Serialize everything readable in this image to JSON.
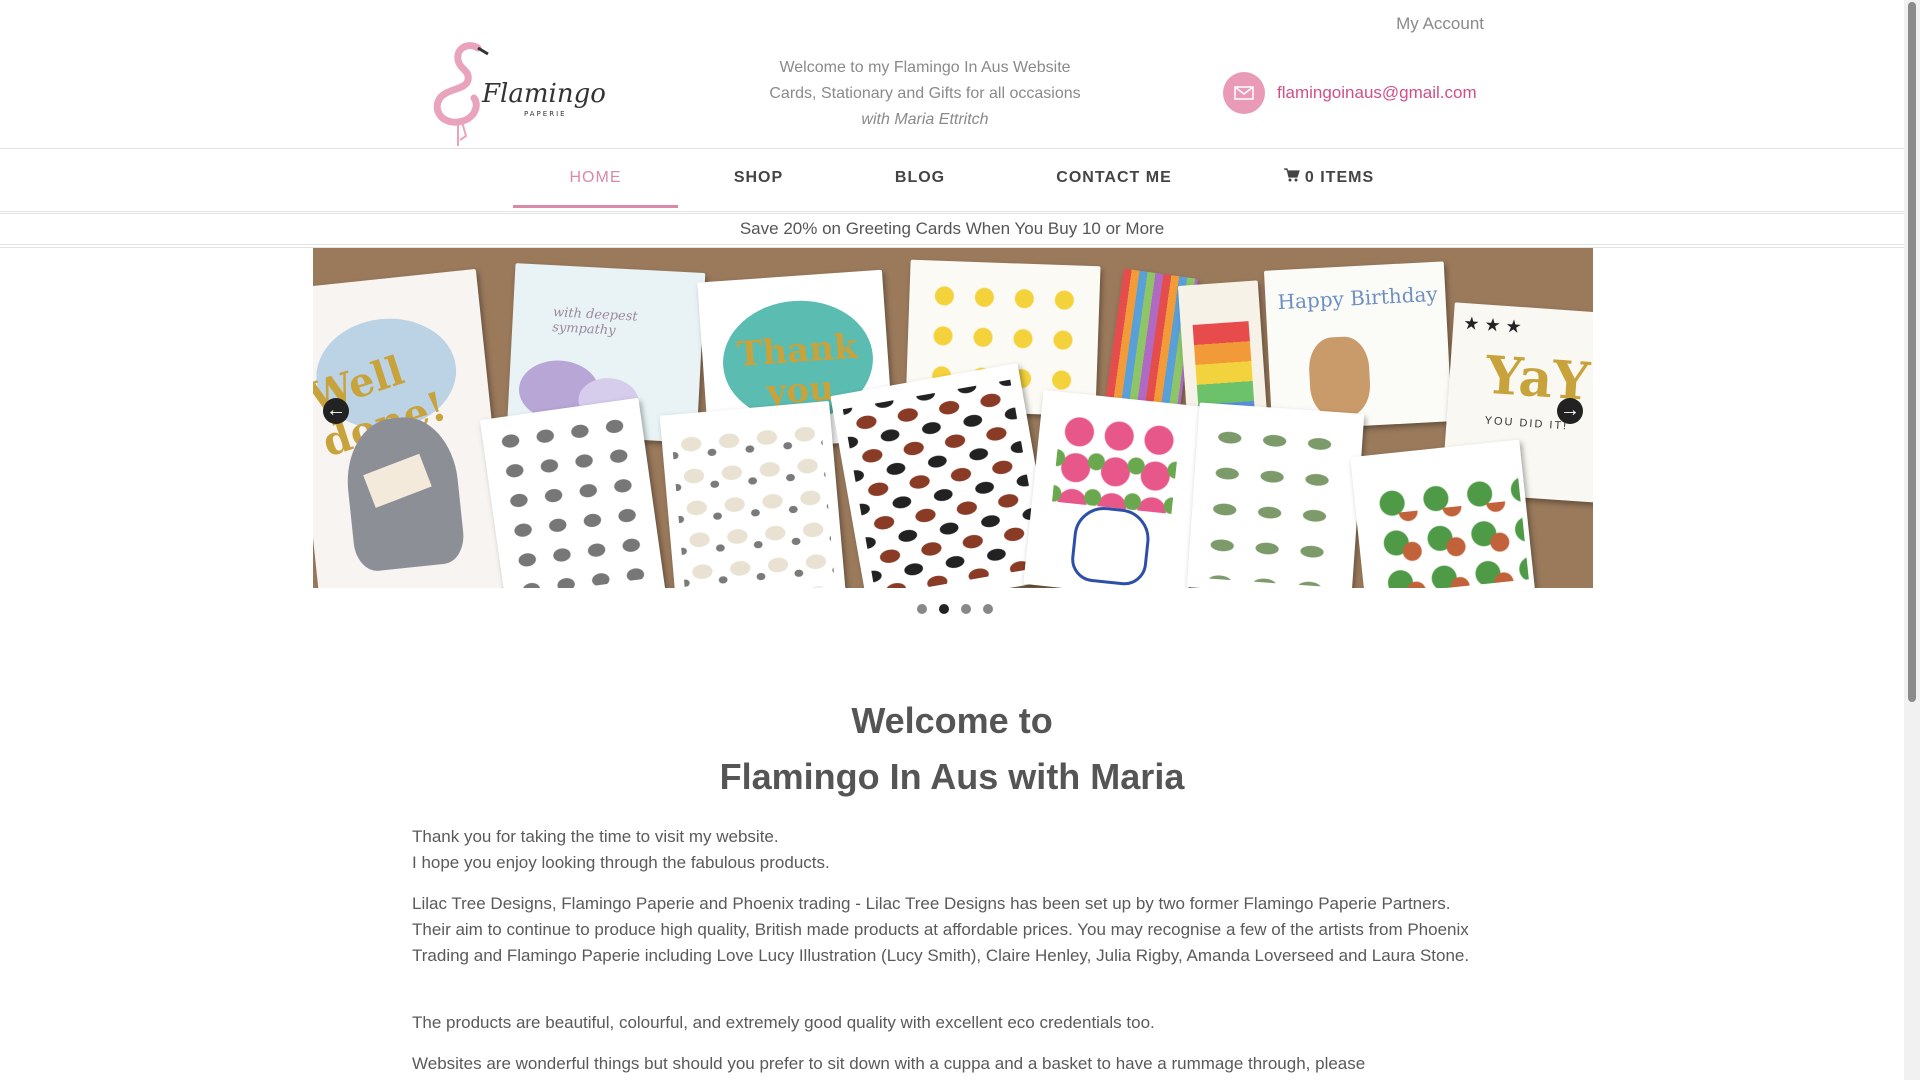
{
  "header": {
    "my_account": "My Account",
    "tagline_line1": "Welcome to my Flamingo In Aus Website",
    "tagline_line2": "Cards, Stationary and Gifts for all occasions",
    "tagline_line3": "with Maria Ettritch",
    "email": "flamingoinaus@gmail.com",
    "logo_text": "Flamingo",
    "logo_sub": "PAPERIE"
  },
  "nav": {
    "items": [
      {
        "label": "HOME",
        "active": true
      },
      {
        "label": "SHOP"
      },
      {
        "label": "BLOG"
      },
      {
        "label": "CONTACT ME"
      },
      {
        "label": "0 ITEMS"
      }
    ]
  },
  "promo": "Save 20% on Greeting Cards When You Buy 10 or More",
  "slider": {
    "cards_text": {
      "well_done": "Well done!",
      "sympathy": "with deepest sympathy",
      "thank_you": "Thank you",
      "happy_birthday": "Happy Birthday",
      "yay": "YaY!",
      "you_did_it": "YOU DID IT!"
    },
    "dot_count": 4,
    "active_dot": 2
  },
  "welcome": {
    "heading1": "Welcome to",
    "heading2": "Flamingo In Aus with Maria",
    "p1_line1": "Thank you for taking the time to visit my website.",
    "p1_line2": "I hope you enjoy looking through the fabulous products.",
    "p2": "Lilac Tree Designs, Flamingo Paperie and Phoenix trading - Lilac Tree Designs has been set up by two former Flamingo Paperie Partners. Their aim to continue to produce high quality, British made products at affordable prices. You may recognise a few of the artists from Phoenix Trading and Flamingo Paperie including Love Lucy Illustration (Lucy Smith), Claire Henley, Julia Rigby, Amanda Loverseed and Laura Stone.",
    "p3": "The products are beautiful, colourful, and extremely good quality with excellent eco credentials too.",
    "p4": "Websites are wonderful things but should you prefer to sit down with a cuppa and a basket to have a rummage through, please"
  },
  "colors": {
    "accent_pink": "#d98aa8",
    "email_pink": "#d04f8a",
    "slider_bg": "#9b7a5c"
  }
}
